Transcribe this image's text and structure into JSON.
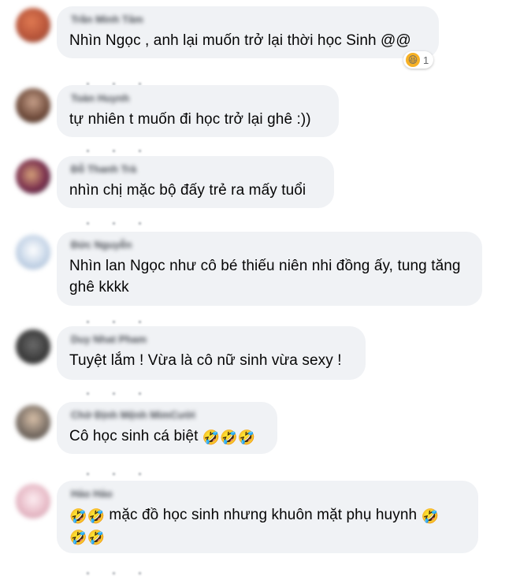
{
  "comments": [
    {
      "name": "Trần Minh Tâm",
      "text": "Nhìn Ngọc , anh lại muốn trở lại thời học Sinh @@",
      "reaction": {
        "icon": "haha-reaction-icon",
        "count": "1"
      }
    },
    {
      "name": "Toàn Huynh",
      "text": "tự nhiên t muốn đi học trở lại ghê :))"
    },
    {
      "name": "Đỗ Thanh Trà",
      "text": "nhìn chị mặc bộ đấy trẻ ra mấy tuổi"
    },
    {
      "name": "Đức Nguyễn",
      "text": "Nhìn lan Ngọc như cô bé thiếu niên nhi đồng ấy, tung tăng ghê kkkk"
    },
    {
      "name": "Duy Nhat Pham",
      "text": "Tuyệt lắm ! Vừa là cô nữ sinh vừa sexy !"
    },
    {
      "name": "Chờ Định Mệnh MimCười",
      "text": "Cô học sinh cá biệt ",
      "emoji": "🤣🤣🤣"
    },
    {
      "name": "Hảo Hảo",
      "emoji_before": "🤣🤣",
      "text": " mặc đồ học sinh nhưng khuôn mặt phụ huynh ",
      "emoji": "🤣",
      "emoji_line2": "🤣🤣"
    }
  ]
}
